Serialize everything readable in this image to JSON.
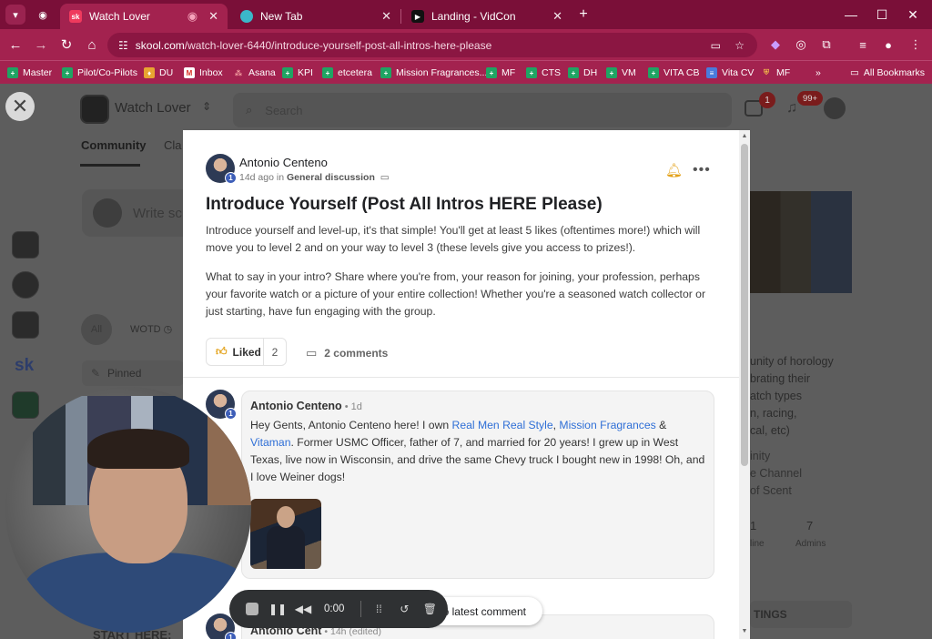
{
  "browser": {
    "tabs": [
      {
        "title": "Watch Lover",
        "favicon": "sk",
        "active": true
      },
      {
        "title": "New Tab",
        "favicon": "new-tab-icon",
        "active": false
      },
      {
        "title": "Landing - VidCon",
        "favicon": "play-icon",
        "active": false
      }
    ],
    "url_domain": "skool.com",
    "url_path": "/watch-lover-6440/introduce-yourself-post-all-intros-here-please",
    "bookmarks": [
      "Master",
      "Pilot/Co-Pilots",
      "DU",
      "Inbox",
      "Asana",
      "KPI",
      "etcetera",
      "Mission Fragrances...",
      "MF",
      "CTS",
      "DH",
      "VM",
      "VITA CB",
      "Vita CV",
      "MF"
    ],
    "bookmarks_more": "»",
    "all_bookmarks": "All Bookmarks"
  },
  "community": {
    "name": "Watch Lover",
    "search_placeholder": "Search",
    "nav_tabs": [
      "Community",
      "Cla"
    ],
    "write_placeholder": "Write sc",
    "filter_all": "All",
    "filter_wotd": "WOTD",
    "pinned_label": "Pinned",
    "start_here": "START HERE:",
    "notif_chat_count": "1",
    "notif_bell_count": "99+",
    "about_lines": [
      "unity of horology",
      "brating their",
      "atch types",
      "n, racing,",
      "cal, etc)"
    ],
    "about_links": [
      "inity",
      "e Channel",
      "of Scent"
    ],
    "stats": [
      {
        "value": "1",
        "label": "line"
      },
      {
        "value": "7",
        "label": "Admins"
      }
    ],
    "settings_label": "TINGS"
  },
  "post": {
    "author": "Antonio Centeno",
    "author_level": "1",
    "time_ago": "14d ago",
    "in_word": "in",
    "category": "General discussion",
    "title": "Introduce Yourself (Post All Intros HERE Please)",
    "body_1": "Introduce yourself and level-up, it's that simple! You'll get at least 5 likes (oftentimes more!) which will move you to level 2 and on your way to level 3 (these levels give you access to prizes!).",
    "body_2": "What to say in your intro? Share where you're from, your reason for joining, your profession, perhaps your favorite watch or a picture of your entire collection! Whether you're a seasoned watch collector or just starting, have fun engaging with the group.",
    "like_label": "Liked",
    "like_count": "2",
    "comments_label": "2 comments"
  },
  "comments": [
    {
      "author": "Antonio Centeno",
      "time": "1d",
      "level": "1",
      "text_1": "Hey Gents, Antonio Centeno here! I own ",
      "link_1": "Real Men Real Style",
      "text_2": ", ",
      "link_2": "Mission Fragrances",
      "text_3": " & ",
      "link_3": "Vitaman",
      "text_4": ". Former USMC Officer, father of 7, and married for 20 years! I grew up in West Texas, live now in Wisconsin, and drive the same Chevy truck I bought new in 1998! Oh, and I love Weiner dogs!"
    },
    {
      "author": "Antonio Cent",
      "time": "14h (edited)",
      "level": "1"
    }
  ],
  "recorder": {
    "time": "0:00",
    "jump_label": "to latest comment"
  }
}
